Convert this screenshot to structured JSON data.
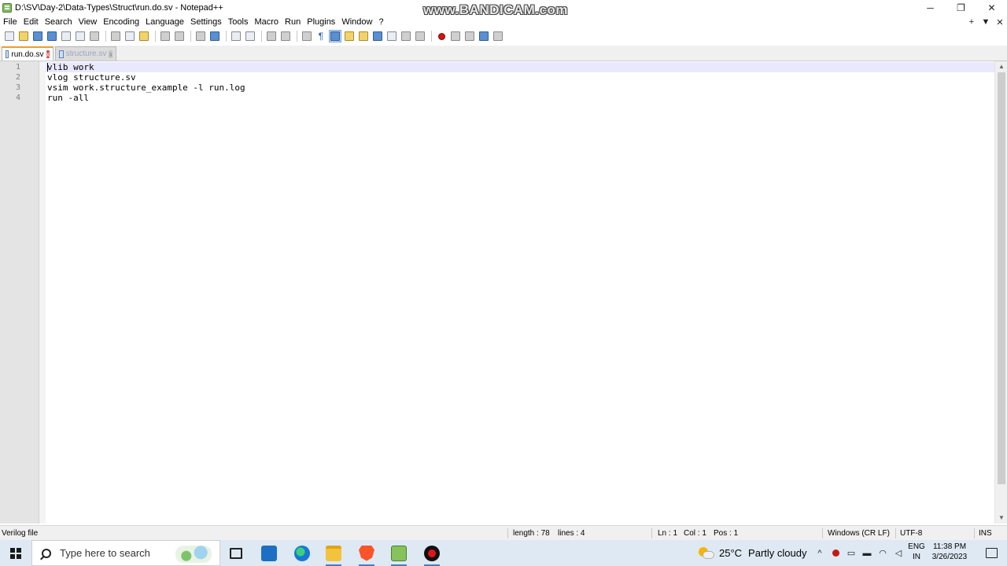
{
  "window": {
    "title": "D:\\SV\\Day-2\\Data-Types\\Struct\\run.do.sv - Notepad++",
    "watermark": "www.BANDICAM.com",
    "controls": {
      "minimize": "─",
      "restore": "❐",
      "close": "✕"
    }
  },
  "menu": {
    "items": [
      "File",
      "Edit",
      "Search",
      "View",
      "Encoding",
      "Language",
      "Settings",
      "Tools",
      "Macro",
      "Run",
      "Plugins",
      "Window",
      "?"
    ],
    "right": {
      "add": "+",
      "dropdown": "▼",
      "close": "✕"
    }
  },
  "tabs": [
    {
      "label": "run.do.sv",
      "active": true,
      "close": "x"
    },
    {
      "label": "structure.sv",
      "active": false,
      "close": "x"
    }
  ],
  "editor": {
    "lines": [
      {
        "number": "1",
        "text": "vlib work"
      },
      {
        "number": "2",
        "text": "vlog structure.sv"
      },
      {
        "number": "3",
        "text": "vsim work.structure_example -l run.log"
      },
      {
        "number": "4",
        "text": "run -all"
      }
    ]
  },
  "status": {
    "file_type": "Verilog file",
    "length": "length : 78",
    "lines": "lines : 4",
    "ln": "Ln : 1",
    "col": "Col : 1",
    "pos": "Pos : 1",
    "eol": "Windows (CR LF)",
    "encoding": "UTF-8",
    "mode": "INS"
  },
  "taskbar": {
    "search_placeholder": "Type here to search",
    "weather_temp": "25°C",
    "weather_desc": "Partly cloudy",
    "lang_line1": "ENG",
    "lang_line2": "IN",
    "time": "11:38 PM",
    "date": "3/26/2023",
    "tray_chevron": "^"
  },
  "colors": {
    "current_line": "#e8e8ff",
    "active_tab_accent": "#f0a030",
    "gutter": "#e4e4e4",
    "taskbar": "#dfe9f3"
  }
}
